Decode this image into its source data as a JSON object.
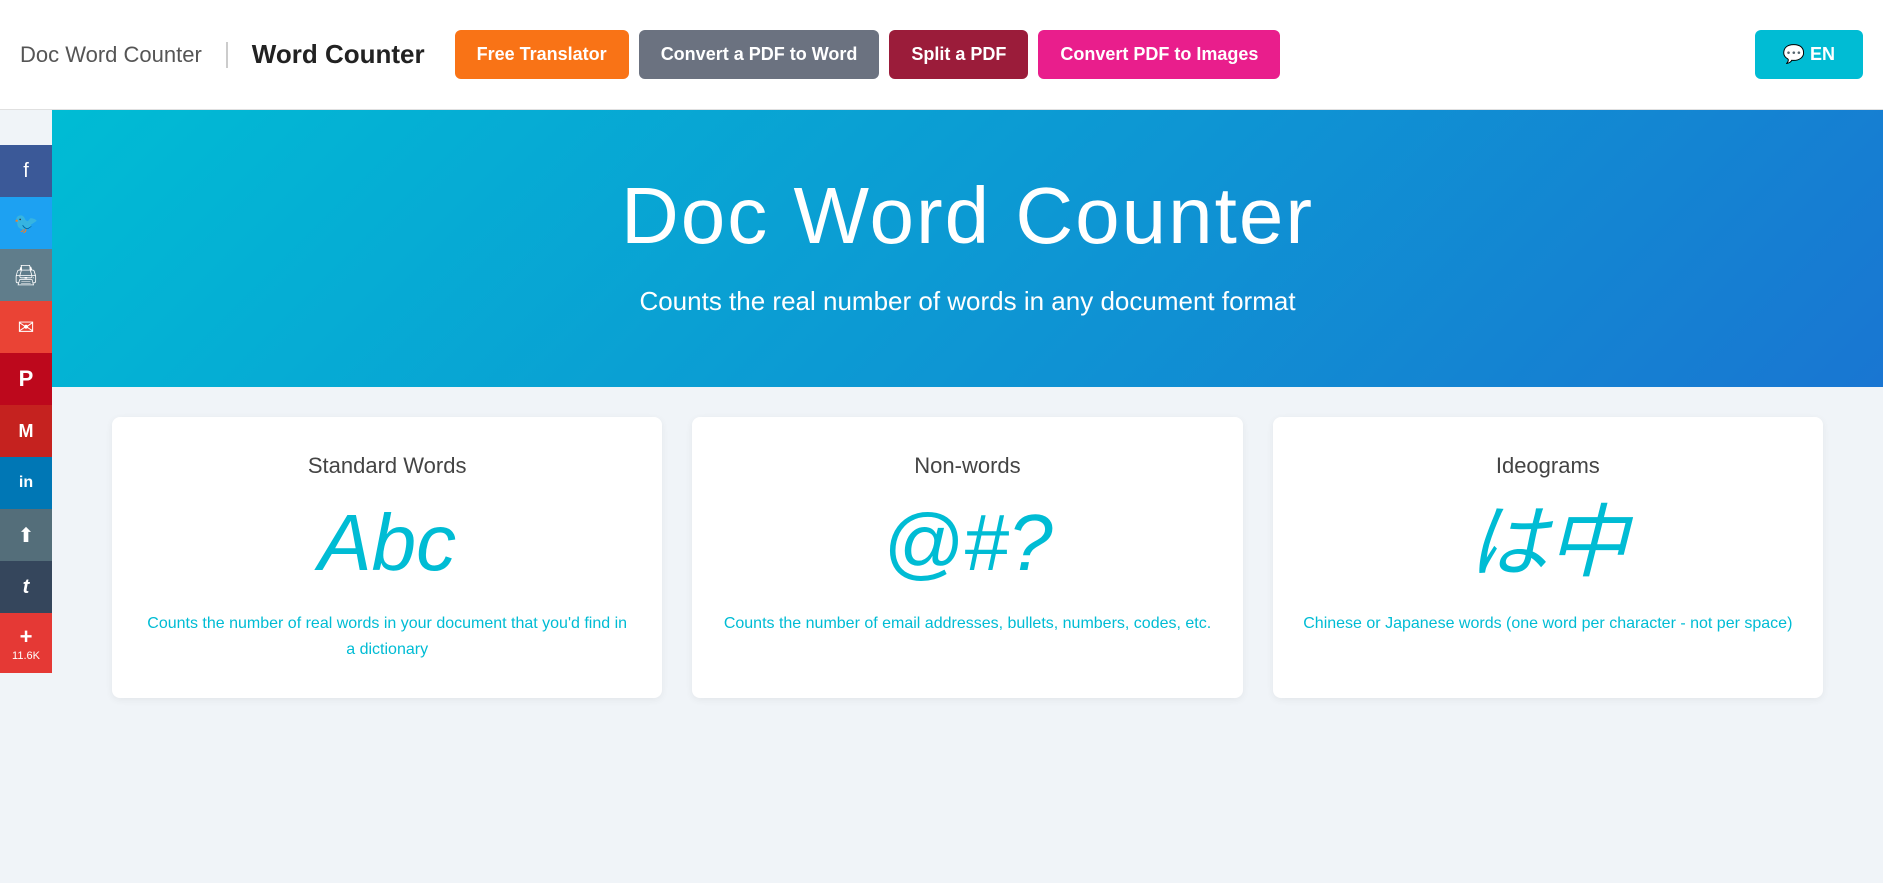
{
  "header": {
    "doc_word_counter": "Doc Word Counter",
    "word_counter": "Word Counter",
    "nav_buttons": [
      {
        "label": "Free Translator",
        "style": "btn-orange"
      },
      {
        "label": "Convert a PDF to Word",
        "style": "btn-gray"
      },
      {
        "label": "Split a PDF",
        "style": "btn-dark-red"
      },
      {
        "label": "Convert PDF to Images",
        "style": "btn-pink"
      }
    ],
    "lang_button": "💬 EN"
  },
  "social": {
    "buttons": [
      {
        "icon": "f",
        "label": "facebook",
        "class": "social-facebook",
        "symbol": "f"
      },
      {
        "icon": "🐦",
        "label": "twitter",
        "class": "social-twitter",
        "symbol": "🐦"
      },
      {
        "icon": "🖨",
        "label": "print",
        "class": "social-print",
        "symbol": "🖨"
      },
      {
        "icon": "✉",
        "label": "email",
        "class": "social-email",
        "symbol": "✉"
      },
      {
        "icon": "P",
        "label": "pinterest",
        "class": "social-pinterest",
        "symbol": "P"
      },
      {
        "icon": "M",
        "label": "gmail",
        "class": "social-gmail",
        "symbol": "M"
      },
      {
        "icon": "in",
        "label": "linkedin",
        "class": "social-linkedin",
        "symbol": "in"
      },
      {
        "icon": "⬆",
        "label": "share",
        "class": "social-share",
        "symbol": "⬆"
      },
      {
        "icon": "t",
        "label": "tumblr",
        "class": "social-tumblr",
        "symbol": "t"
      },
      {
        "icon": "+",
        "label": "more",
        "class": "social-more",
        "symbol": "+",
        "count": "11.6K"
      }
    ]
  },
  "hero": {
    "title": "Doc Word Counter",
    "subtitle": "Counts the real number of words in any document format"
  },
  "cards": [
    {
      "title": "Standard Words",
      "icon": "Abc",
      "desc": "Counts the number of real words in your document that you'd find in a dictionary"
    },
    {
      "title": "Non-words",
      "icon": "@#?",
      "desc": "Counts the number of email addresses, bullets, numbers, codes, etc."
    },
    {
      "title": "Ideograms",
      "icon": "は中",
      "desc": "Chinese or Japanese words (one word per character - not per space)"
    }
  ]
}
